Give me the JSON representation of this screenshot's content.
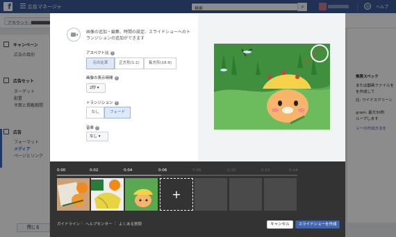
{
  "app": {
    "title": "広告マネージャ",
    "search_placeholder": "検索",
    "help": "ヘルプ"
  },
  "account": {
    "label": "アカウント: ▇▇▇▇▇▇▇"
  },
  "sidebar": {
    "campaign": {
      "title": "キャンペーン",
      "items": [
        "広告の目的"
      ]
    },
    "adset": {
      "title": "広告セット",
      "items": [
        "ターゲット",
        "配置",
        "予算と掲載期間"
      ]
    },
    "ad": {
      "title": "広告",
      "items": [
        "フォーマット",
        "メディア",
        "ページとリンク"
      ]
    },
    "close": "閉じる"
  },
  "right_panel": {
    "lines": [
      "推奨スペック",
      "または動画ファイルを",
      "を作成して",
      "比: ワイドスクリーン",
      "gram: 最大30秒",
      "ループします",
      "ョーの作成方法を"
    ]
  },
  "modal": {
    "intro": "画像の追加・編集、時間の設定、スライドショーへのトランジションの追加ができます",
    "aspect": {
      "label": "アスペクト比",
      "options": [
        "元の比率",
        "正方形(1:1)",
        "長方形(16:9)"
      ],
      "selected": 0
    },
    "duration": {
      "label": "画像の表示時間",
      "value": "2秒"
    },
    "transition": {
      "label": "トランジション",
      "options": [
        "なし",
        "フェード"
      ],
      "selected": 1
    },
    "music": {
      "label": "音楽",
      "value": "なし"
    }
  },
  "timeline": {
    "ticks": [
      "0:00",
      "0:02",
      "0:04",
      "0:06",
      "0:08",
      "0:10",
      "0:12",
      "0:14"
    ],
    "add": "+"
  },
  "footer": {
    "links": [
      "ガイドライン",
      "ヘルプセンター",
      "よくある質問"
    ],
    "cancel": "キャンセル",
    "create": "スライドショーを作成"
  }
}
